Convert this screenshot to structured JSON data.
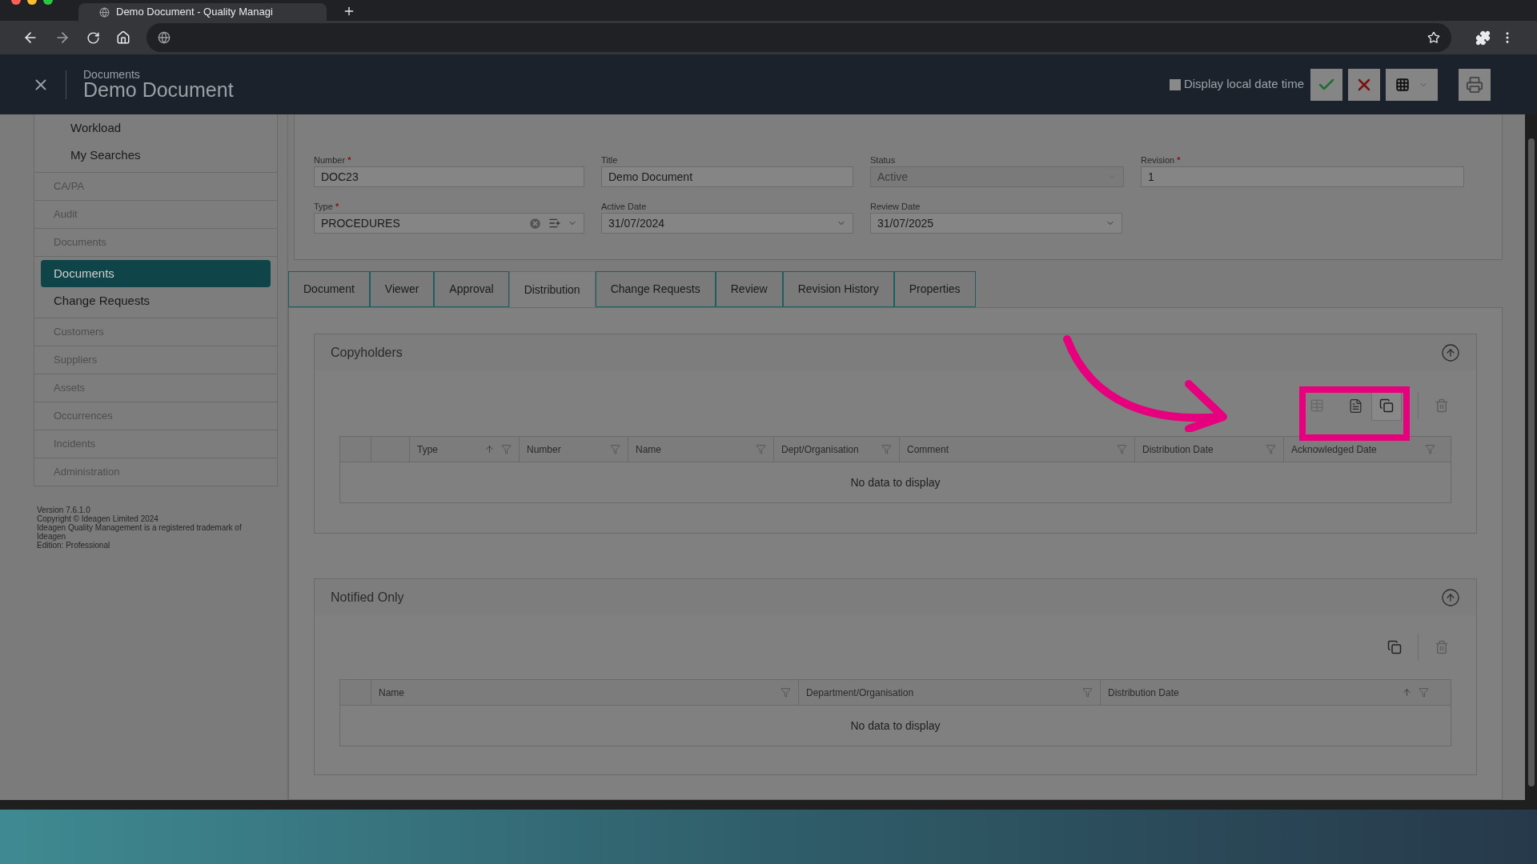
{
  "browser": {
    "tab_title": "Demo Document - Quality Managi"
  },
  "app_header": {
    "breadcrumb": "Documents",
    "title": "Demo Document",
    "local_date": {
      "label": "Display local date time",
      "checked": false
    }
  },
  "sidebar": {
    "top_items": [
      {
        "label": "Workload",
        "selected": false
      },
      {
        "label": "My Searches",
        "selected": false
      }
    ],
    "sections": [
      {
        "label": "CA/PA"
      },
      {
        "label": "Audit"
      },
      {
        "label": "Documents",
        "children": [
          {
            "label": "Documents",
            "selected": true
          },
          {
            "label": "Change Requests",
            "selected": false
          }
        ]
      },
      {
        "label": "Customers"
      },
      {
        "label": "Suppliers"
      },
      {
        "label": "Assets"
      },
      {
        "label": "Occurrences"
      },
      {
        "label": "Incidents"
      },
      {
        "label": "Administration"
      }
    ],
    "footer": [
      "Version 7.6.1.0",
      "Copyright © Ideagen Limited 2024",
      "Ideagen Quality Management is a registered trademark of Ideagen",
      "Edition: Professional"
    ]
  },
  "summary": {
    "fields": [
      {
        "kind": "text",
        "label": "Number",
        "required_mark": "*",
        "value": "DOC23",
        "disabled": false
      },
      {
        "kind": "text",
        "label": "Title",
        "value": "Demo Document",
        "disabled": false
      },
      {
        "kind": "select",
        "label": "Status",
        "value": "Active",
        "disabled": true
      },
      {
        "kind": "text",
        "label": "Revision",
        "required_mark": "*",
        "value": "1",
        "disabled": false
      },
      {
        "kind": "type",
        "label": "Type",
        "required_mark": "*",
        "value": "PROCEDURES",
        "disabled": false
      },
      {
        "kind": "select",
        "label": "Active Date",
        "value": "31/07/2024",
        "disabled": false
      },
      {
        "kind": "select",
        "label": "Review Date",
        "value": "31/07/2025",
        "disabled": false
      }
    ]
  },
  "tabs": [
    {
      "label": "Document",
      "selected": false
    },
    {
      "label": "Viewer",
      "selected": false
    },
    {
      "label": "Approval",
      "selected": false
    },
    {
      "label": "Distribution",
      "selected": true
    },
    {
      "label": "Change Requests",
      "selected": false
    },
    {
      "label": "Review",
      "selected": false
    },
    {
      "label": "Revision History",
      "selected": false
    },
    {
      "label": "Properties",
      "selected": false
    }
  ],
  "copyholders": {
    "title": "Copyholders",
    "columns": [
      {
        "label": "Type",
        "sorted": true
      },
      {
        "label": "Number",
        "sorted": false
      },
      {
        "label": "Name",
        "sorted": false
      },
      {
        "label": "Dept/Organisation",
        "sorted": false
      },
      {
        "label": "Comment",
        "sorted": false
      },
      {
        "label": "Distribution Date",
        "sorted": false
      },
      {
        "label": "Acknowledged Date",
        "sorted": false
      }
    ],
    "empty": "No data to display"
  },
  "notified_only": {
    "title": "Notified Only",
    "columns": [
      {
        "label": "Name",
        "sorted": false
      },
      {
        "label": "Department/Organisation",
        "sorted": false
      },
      {
        "label": "Distribution Date",
        "sorted": true
      }
    ],
    "empty": "No data to display"
  }
}
